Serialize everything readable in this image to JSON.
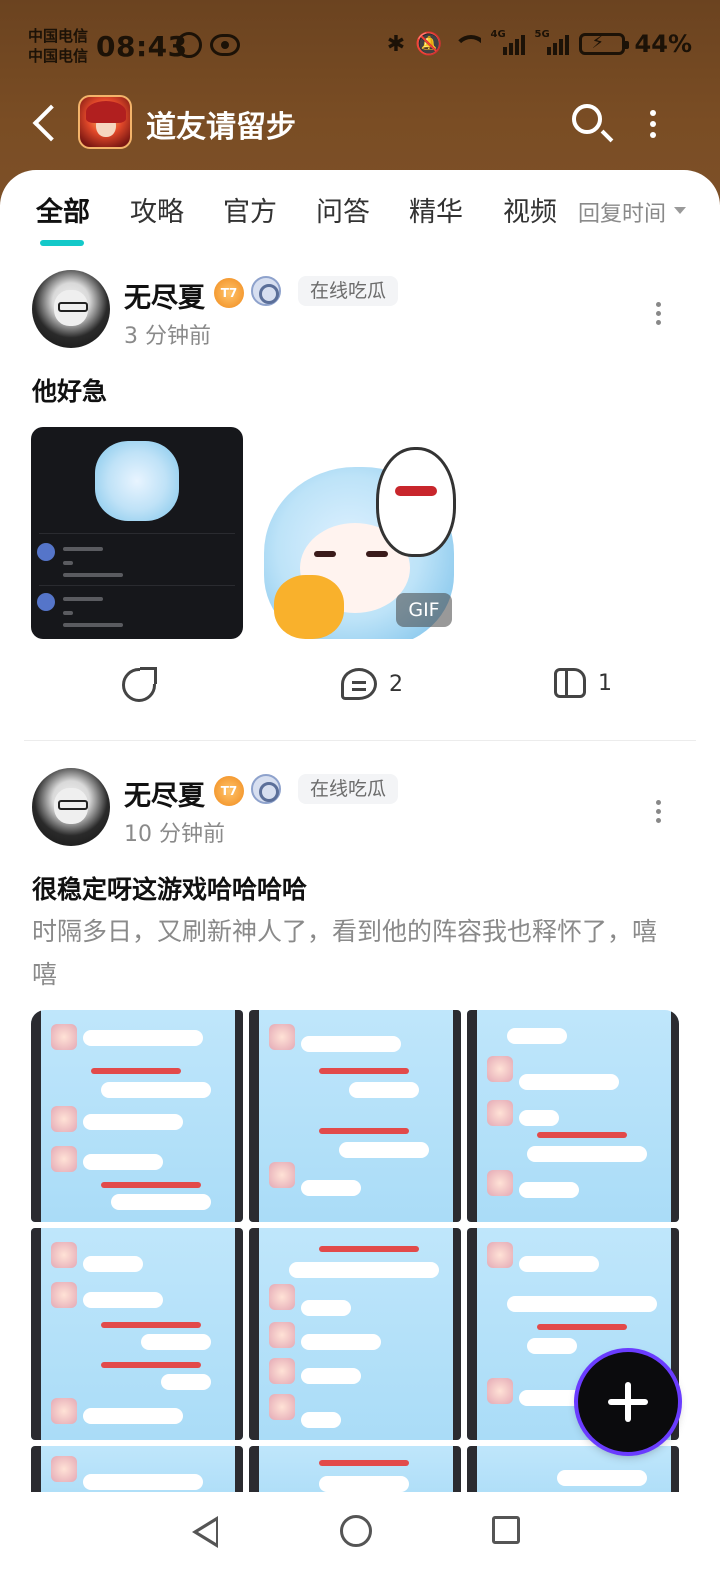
{
  "status_bar": {
    "carrier_1": "中国电信",
    "carrier_2": "中国电信",
    "time": "08:43",
    "network_1": "4G",
    "network_2": "5G",
    "battery": "44%"
  },
  "header": {
    "title": "道友请留步"
  },
  "tabs": {
    "items": [
      "全部",
      "攻略",
      "官方",
      "问答",
      "精华",
      "视频"
    ],
    "active": "全部",
    "sort_label": "回复时间"
  },
  "posts": [
    {
      "username": "无尽夏",
      "level": "T7",
      "tag": "在线吃瓜",
      "time": "3 分钟前",
      "title": "他好急",
      "gif_label": "GIF",
      "comments": "2",
      "likes": "1"
    },
    {
      "username": "无尽夏",
      "level": "T7",
      "tag": "在线吃瓜",
      "time": "10 分钟前",
      "title": "很稳定呀这游戏哈哈哈哈",
      "body": "时隔多日，又刷新神人了，看到他的阵容我也释怀了，嘻嘻"
    }
  ],
  "colors": {
    "header_brown": "#7a4d24",
    "tab_accent": "#14c9c9"
  }
}
